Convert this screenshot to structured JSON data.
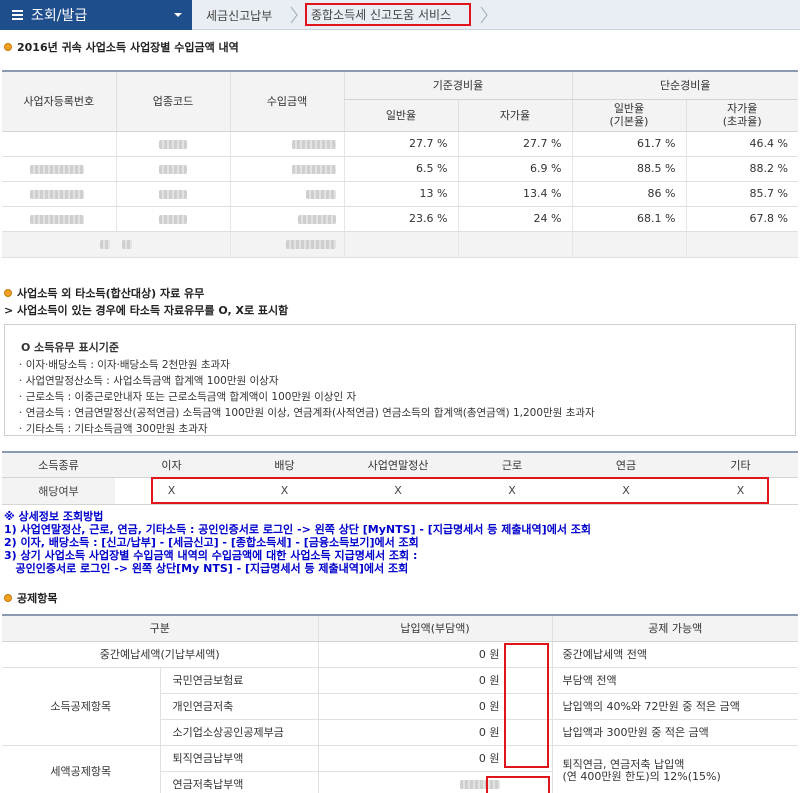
{
  "nav": {
    "main_label": "조회/발급",
    "crumb1": "세금신고납부",
    "crumb2": "종합소득세 신고도움 서비스"
  },
  "colors": {
    "nav_bg": "#1f4e8c",
    "highlight": "#e0151c",
    "bullet": "#f0a023",
    "guide_text": "#0000cc"
  },
  "section1": {
    "title": "2016년 귀속 사업소득 사업장별 수입금액 내역",
    "headers": {
      "biz_no": "사업자등록번호",
      "industry_code": "업종코드",
      "income": "수입금액",
      "standard_rate": "기준경비율",
      "simple_rate": "단순경비율",
      "general_rate": "일반율",
      "self_rate": "자가율",
      "general_rate_basic": "일반율\n(기본율)",
      "self_rate_excess": "자가율\n(초과율)"
    },
    "rows": [
      {
        "std_general": "27.7 %",
        "std_self": "27.7 %",
        "simple_general": "61.7 %",
        "simple_self": "46.4 %"
      },
      {
        "std_general": "6.5 %",
        "std_self": "6.9 %",
        "simple_general": "88.5 %",
        "simple_self": "88.2 %"
      },
      {
        "std_general": "13 %",
        "std_self": "13.4 %",
        "simple_general": "86 %",
        "simple_self": "85.7 %"
      },
      {
        "std_general": "23.6 %",
        "std_self": "24 %",
        "simple_general": "68.1 %",
        "simple_self": "67.8 %"
      }
    ]
  },
  "section2": {
    "title": "사업소득 외 타소득(합산대상) 자료 유무",
    "note": "> 사업소득이 있는 경우에 타소득 자료유무를 O, X로 표시함",
    "criteria_title": "O  소득유무 표시기준",
    "criteria": [
      "이자·배당소득 : 이자·배당소득 2천만원 초과자",
      "사업연말정산소득 : 사업소득금액 합계액 100만원 이상자",
      "근로소득 : 이중근로안내자 또는 근로소득금액 합계액이 100만원 이상인 자",
      "연금소득 : 연금연말정산(공적연금) 소득금액 100만원 이상, 연금계좌(사적연금) 연금소득의 합계액(총연금액) 1,200만원 초과자",
      "기타소득 : 기타소득금액 300만원 초과자"
    ],
    "table_headers": [
      "소득종류",
      "이자",
      "배당",
      "사업연말정산",
      "근로",
      "연금",
      "기타"
    ],
    "row_label": "해당여부",
    "row_values": [
      "X",
      "X",
      "X",
      "X",
      "X",
      "X"
    ]
  },
  "guide": {
    "title": "※ 상세정보 조회방법",
    "lines": [
      "1) 사업연말정산, 근로, 연금, 기타소득 : 공인인증서로 로그인 -> 왼쪽 상단 [MyNTS] - [지급명세서 등 제출내역]에서 조회",
      "2) 이자, 배당소득 : [신고/납부] - [세금신고] - [종합소득세] - [금융소득보기]에서 조회",
      "3) 상기 사업소득 사업장별 수입금액 내역의 수입금액에 대한 사업소득 지급명세서 조회 :",
      "   공인인증서로 로그인 -> 왼쪽 상단[My NTS] - [지급명세서 등 제출내역]에서 조회"
    ]
  },
  "section3": {
    "title": "공제항목",
    "headers": [
      "구분",
      "납입액(부담액)",
      "공제 가능액"
    ],
    "prepaid_label": "중간예납세액(기납부세액)",
    "prepaid_amount": "0 원",
    "prepaid_desc": "중간예납세액 전액",
    "income_deduction_label": "소득공제항목",
    "tax_credit_label": "세액공제항목",
    "items": [
      {
        "label": "국민연금보험료",
        "amount": "0 원",
        "desc": "부담액 전액"
      },
      {
        "label": "개인연금저축",
        "amount": "0 원",
        "desc": "납입액의 40%와 72만원 중 적은 금액"
      },
      {
        "label": "소기업소상공인공제부금",
        "amount": "0 원",
        "desc": "납입액과 300만원 중 적은 금액"
      },
      {
        "label": "퇴직연금납부액",
        "amount": "0 원",
        "desc": "퇴직연금, 연금저축 납입액\n(연 400만원 한도)의 12%(15%)"
      },
      {
        "label": "연금저축납부액",
        "amount": "",
        "desc": ""
      }
    ]
  }
}
